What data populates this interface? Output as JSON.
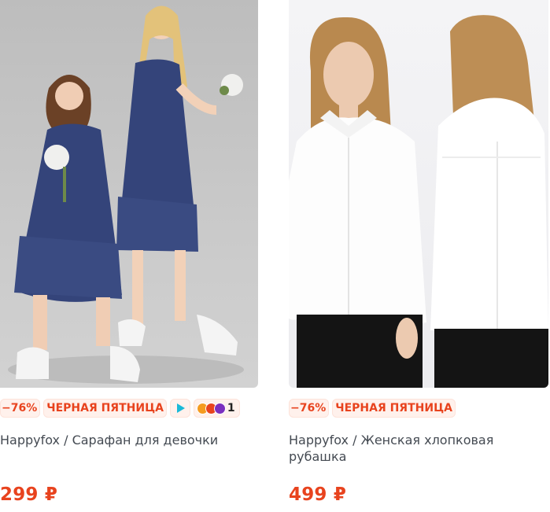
{
  "products": [
    {
      "discount": "−76%",
      "promo": "ЧЕРНАЯ ПЯТНИЦА",
      "reviews_count": "1",
      "title": "Happyfox / Сарафан для девочки",
      "price": "299 ₽"
    },
    {
      "discount": "−76%",
      "promo": "ЧЕРНАЯ ПЯТНИЦА",
      "title": "Happyfox / Женская хлопковая рубашка",
      "price": "499 ₽"
    }
  ],
  "colors": {
    "accent": "#e8431e",
    "badge_bg": "#fff1ec",
    "video_icon": "#19b9d8",
    "title_text": "#444a52"
  }
}
